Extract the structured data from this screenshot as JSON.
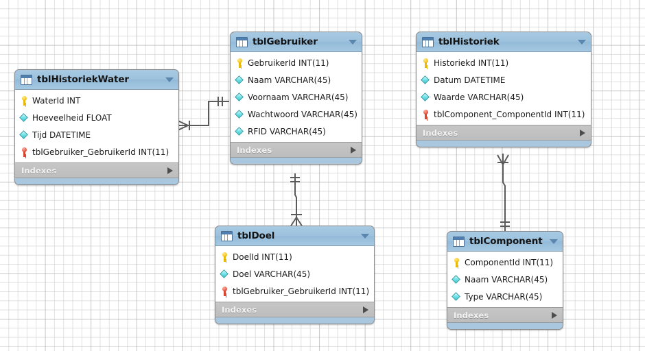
{
  "diagram": {
    "title": "EER Diagram",
    "background": "#ffffff",
    "grid_color": "#c8c8c8",
    "header_color": "#9dc2dd",
    "index_bar_color": "#bdbdbd",
    "pk_icon_color": "#f4c211",
    "fk_icon_color": "#e0503a",
    "column_icon_color": "#79e6ea"
  },
  "tables": [
    {
      "name": "tblHistoriekWater",
      "icon": "table-icon",
      "caret": "chevron-down-icon",
      "indexes_label": "Indexes",
      "indexes_caret": "chevron-right-icon",
      "columns": [
        {
          "icon": "primary-key-icon",
          "label": "WaterId INT"
        },
        {
          "icon": "column-icon",
          "label": "Hoeveelheid FLOAT"
        },
        {
          "icon": "column-icon",
          "label": "Tijd DATETIME"
        },
        {
          "icon": "foreign-key-icon",
          "label": "tblGebruiker_GebruikerId INT(11)"
        }
      ]
    },
    {
      "name": "tblGebruiker",
      "icon": "table-icon",
      "caret": "chevron-down-icon",
      "indexes_label": "Indexes",
      "indexes_caret": "chevron-right-icon",
      "columns": [
        {
          "icon": "primary-key-icon",
          "label": "GebruikerId INT(11)"
        },
        {
          "icon": "column-icon",
          "label": "Naam  VARCHAR(45)"
        },
        {
          "icon": "column-icon",
          "label": "Voornaam  VARCHAR(45)"
        },
        {
          "icon": "column-icon",
          "label": "Wachtwoord VARCHAR(45)"
        },
        {
          "icon": "column-icon",
          "label": "RFID VARCHAR(45)"
        }
      ]
    },
    {
      "name": "tblHistoriek",
      "icon": "table-icon",
      "caret": "chevron-down-icon",
      "indexes_label": "Indexes",
      "indexes_caret": "chevron-right-icon",
      "columns": [
        {
          "icon": "primary-key-icon",
          "label": "Historiekd INT(11)"
        },
        {
          "icon": "column-icon",
          "label": "Datum  DATETIME"
        },
        {
          "icon": "column-icon",
          "label": "Waarde VARCHAR(45)"
        },
        {
          "icon": "foreign-key-icon",
          "label": "tblComponent_ComponentId INT(11)"
        }
      ]
    },
    {
      "name": "tblDoel",
      "icon": "table-icon",
      "caret": "chevron-down-icon",
      "indexes_label": "Indexes",
      "indexes_caret": "chevron-right-icon",
      "columns": [
        {
          "icon": "primary-key-icon",
          "label": "DoelId INT(11)"
        },
        {
          "icon": "column-icon",
          "label": "Doel VARCHAR(45)"
        },
        {
          "icon": "foreign-key-icon",
          "label": "tblGebruiker_GebruikerId INT(11)"
        }
      ]
    },
    {
      "name": "tblComponent",
      "icon": "table-icon",
      "caret": "chevron-down-icon",
      "indexes_label": "Indexes",
      "indexes_caret": "chevron-right-icon",
      "columns": [
        {
          "icon": "primary-key-icon",
          "label": "ComponentId INT(11)"
        },
        {
          "icon": "column-icon",
          "label": "Naam  VARCHAR(45)"
        },
        {
          "icon": "column-icon",
          "label": "Type VARCHAR(45)"
        }
      ]
    }
  ],
  "relationships": [
    {
      "name": "tblHistoriekWater-to-tblGebruiker",
      "from_table": "tblHistoriekWater",
      "from_cardinality": "many",
      "to_table": "tblGebruiker",
      "to_cardinality": "one"
    },
    {
      "name": "tblGebruiker-to-tblDoel",
      "from_table": "tblGebruiker",
      "from_cardinality": "one",
      "to_table": "tblDoel",
      "to_cardinality": "many"
    },
    {
      "name": "tblHistoriek-to-tblComponent",
      "from_table": "tblHistoriek",
      "from_cardinality": "many",
      "to_table": "tblComponent",
      "to_cardinality": "one"
    }
  ]
}
